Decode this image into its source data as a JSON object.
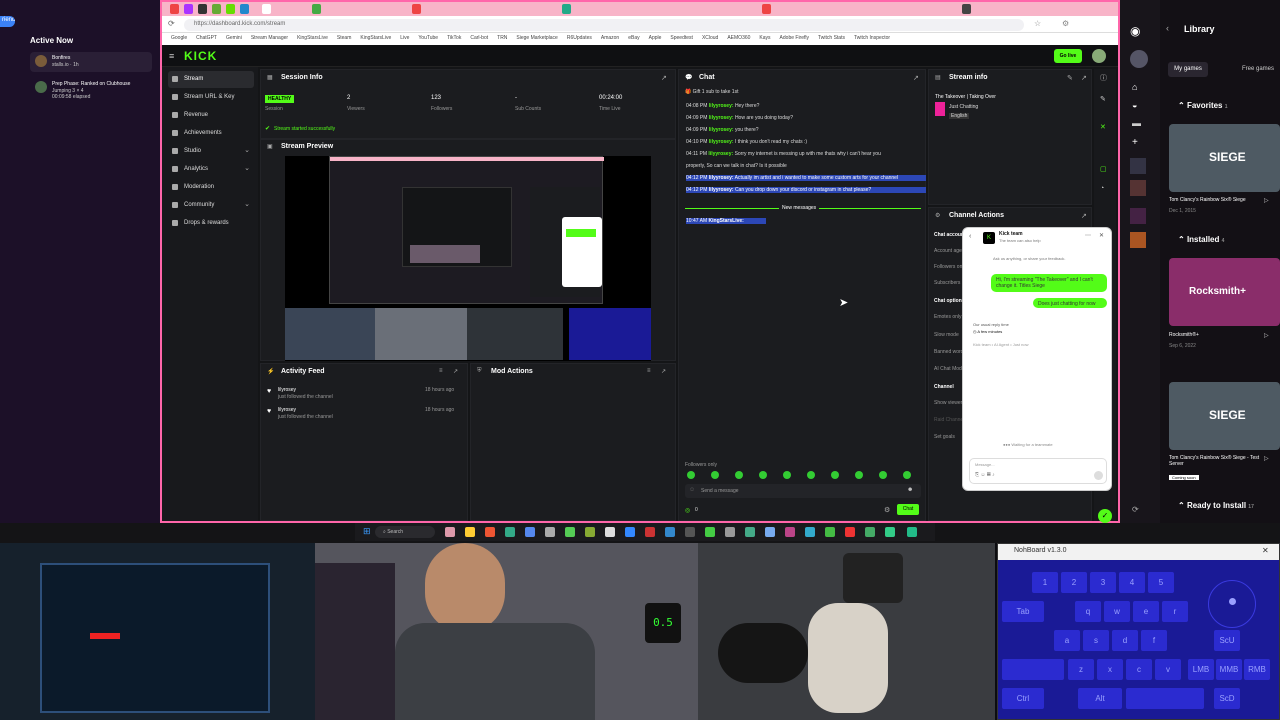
{
  "left_panel": {
    "friend_tab": "riend",
    "title": "Active Now",
    "items": [
      {
        "name": "Bonfires",
        "sub": "stalls.io · 1h"
      },
      {
        "name": "Prep Phase: Ranked on Clubhouse",
        "sub": "Jumping 3 × 4",
        "extra": "00:09:58 elapsed"
      }
    ]
  },
  "browser": {
    "url": "https://dashboard.kick.com/stream",
    "bookmarks": [
      "Google",
      "ChatGPT",
      "Gemini",
      "Stream Manager",
      "KingStarsLive",
      "Steam",
      "KingStarsLive",
      "Live",
      "YouTube",
      "TikTok",
      "Carl-bot",
      "TRN",
      "Siege Marketplace",
      "R6Updates",
      "Amazon",
      "eBay",
      "Apple",
      "Speedtest",
      "XCloud",
      "AEMO360",
      "Kays",
      "Adobe Firefly",
      "Twitch Stats",
      "Twitch Inspector"
    ]
  },
  "kick": {
    "logo": "KICK",
    "go_live": "Go live",
    "sidebar": [
      "Stream",
      "Stream URL & Key",
      "Revenue",
      "Achievements",
      "Studio",
      "Analytics",
      "Moderation",
      "Community",
      "Drops & rewards"
    ],
    "session": {
      "title": "Session Info",
      "status": "HEALTHY",
      "status_label": "Session",
      "stats": [
        {
          "value": "2",
          "label": "Viewers"
        },
        {
          "value": "123",
          "label": "Followers"
        },
        {
          "value": "-",
          "label": "Sub Counts"
        },
        {
          "value": "00:24:00",
          "label": "Time Live"
        }
      ],
      "notice": "Stream started successfully"
    },
    "preview": {
      "title": "Stream Preview"
    },
    "activity": {
      "title": "Activity Feed",
      "items": [
        {
          "name": "lilyrosey",
          "action": "just followed the channel",
          "time": "18 hours ago"
        },
        {
          "name": "lilyrosey",
          "action": "just followed the channel",
          "time": "18 hours ago"
        }
      ]
    },
    "mod": {
      "title": "Mod Actions"
    },
    "chat": {
      "title": "Chat",
      "gift": "Gift 1 sub to take 1st",
      "messages": [
        {
          "time": "04:08 PM",
          "user": "lilyyrosey:",
          "text": "Hey there?",
          "hl": false
        },
        {
          "time": "04:09 PM",
          "user": "lilyyrosey:",
          "text": "How are you doing today?",
          "hl": false
        },
        {
          "time": "04:09 PM",
          "user": "lilyyrosey:",
          "text": "you there?",
          "hl": false
        },
        {
          "time": "04:10 PM",
          "user": "lilyyrosey:",
          "text": "I think you don't read my chats :)",
          "hl": false
        },
        {
          "time": "04:11 PM",
          "user": "lilyyrosey:",
          "text": "Sorry my internet is messing up with me thats why i can't hear you",
          "hl": false
        },
        {
          "time": "",
          "user": "",
          "text": "properly, So can we talk in chat? Is it possible",
          "hl": false
        },
        {
          "time": "04:12 PM",
          "user": "lilyyrosey:",
          "text": "Actually im artist and i wanted to make some custom arts for your channel",
          "hl": true
        },
        {
          "time": "04:12 PM",
          "user": "lilyyrosey:",
          "text": "Can you drop down your discord or instagram in chat please?",
          "hl": true
        }
      ],
      "new_messages": "New messages",
      "last": {
        "time": "10:47 AM",
        "user": "KingStarsLive:",
        "text": ""
      },
      "placeholder": "Send a message",
      "followers_only": "Followers only",
      "count": "0",
      "send": "Chat"
    },
    "stream_info": {
      "title": "Stream info",
      "stream_title": "The Takeover | Taking Over",
      "category": "Just Chatting",
      "lang": "English"
    },
    "channel_actions": {
      "title": "Channel Actions",
      "section1": "Chat accounts",
      "rows": [
        "Account age",
        "Followers only",
        "Subscribers"
      ],
      "section2": "Chat options",
      "rows2": [
        "Emotes only",
        "Slow mode",
        "Banned words",
        "AI Chat Mod"
      ],
      "section3": "Channel",
      "rows3": [
        "Show viewer count",
        "Raid Channel",
        "Set goals"
      ]
    },
    "support": {
      "title": "Kick team",
      "subtitle": "The team can also help",
      "prompt": "Ask us anything, or share your feedback.",
      "user_msg1": "Hi, I'm streaming \"The Takeover\" and I can't change it. Titles Siege",
      "user_msg2": "Does just chatting for now",
      "reply_label": "Our usual reply time",
      "reply_time": "A few minutes",
      "agent": "Kick team • AI Agent • Just now",
      "waiting": "Waiting for a teammate",
      "placeholder": "Message..."
    }
  },
  "steam": {
    "title": "Library",
    "tabs": [
      "My games",
      "Free games"
    ],
    "favorites": "Favorites",
    "fav_count": "1",
    "installed": "Installed",
    "inst_count": "4",
    "ready": "Ready to Install",
    "ready_count": "17",
    "games": [
      {
        "title": "Tom Clancy's Rainbow Six® Siege",
        "date": "Dec 1, 2015",
        "art": "SIEGE"
      },
      {
        "title": "Rocksmith®+",
        "date": "Sep 6, 2022",
        "art": "Rocksmith+"
      },
      {
        "title": "Tom Clancy's Rainbow Six® Siege - Test Server",
        "date": "Coming soon",
        "art": "SIEGE"
      }
    ]
  },
  "taskbar": {
    "search": "Search"
  },
  "nohboard": {
    "title": "NohBoard v1.3.0",
    "row1": [
      "1",
      "2",
      "3",
      "4",
      "5"
    ],
    "row2": [
      "Tab",
      "q",
      "w",
      "e",
      "r"
    ],
    "row3": [
      "a",
      "s",
      "d",
      "f"
    ],
    "row4": [
      "z",
      "x",
      "c",
      "v"
    ],
    "mods": [
      "Ctrl",
      "Alt"
    ],
    "side": [
      "ScU",
      "LMB",
      "MMB",
      "RMB",
      "ScD"
    ]
  },
  "overlay": {
    "digital": "0.5"
  },
  "colors": {
    "kick_green": "#53fc18",
    "browser_frame": "#ff66aa",
    "nohboard_bg": "#1a1a96"
  }
}
